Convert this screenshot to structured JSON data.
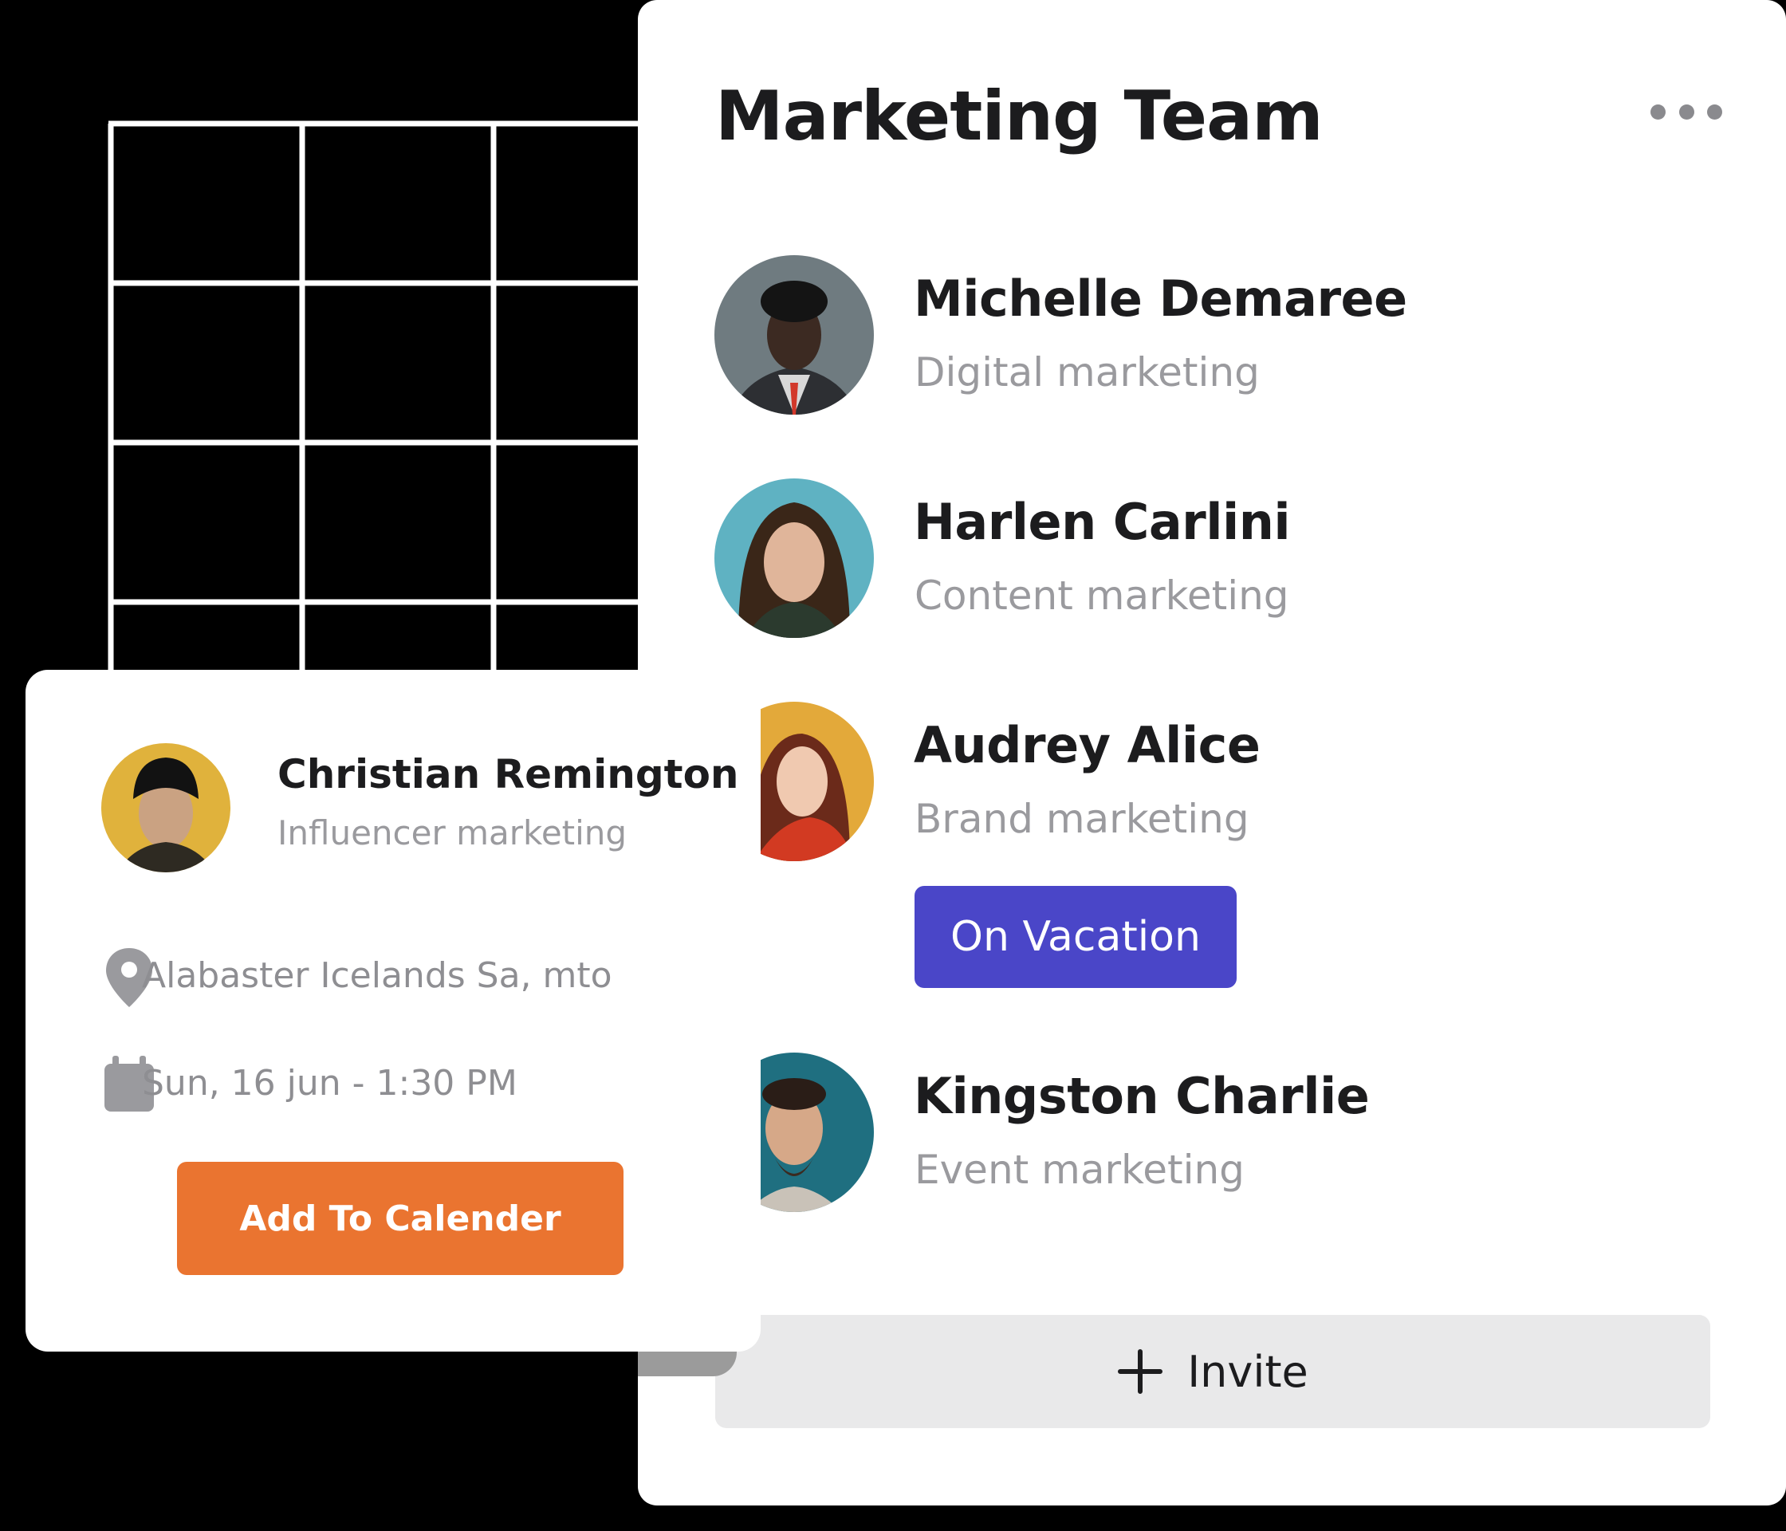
{
  "team_panel": {
    "title": "Marketing Team",
    "more_icon": "more-horizontal-icon",
    "members": [
      {
        "name": "Michelle Demaree",
        "role": "Digital marketing"
      },
      {
        "name": "Harlen Carlini",
        "role": "Content marketing"
      },
      {
        "name": "Audrey Alice",
        "role": "Brand marketing",
        "badge": "On Vacation"
      },
      {
        "name": "Kingston Charlie",
        "role": "Event marketing"
      }
    ],
    "invite": {
      "icon": "plus-icon",
      "label": "Invite"
    }
  },
  "event_card": {
    "name": "Christian Remington",
    "role": "Influencer marketing",
    "location": {
      "icon": "location-pin-icon",
      "text": "Alabaster Icelands Sa, mto"
    },
    "datetime": {
      "icon": "calendar-icon",
      "text": "Sun, 16 jun - 1:30 PM"
    },
    "button_label": "Add To Calender"
  },
  "colors": {
    "background": "#000000",
    "card": "#ffffff",
    "vacation_badge": "#4a46c8",
    "calendar_button": "#ea7430",
    "invite_button": "#e9e9ea",
    "muted_text": "#9a9a9e"
  }
}
